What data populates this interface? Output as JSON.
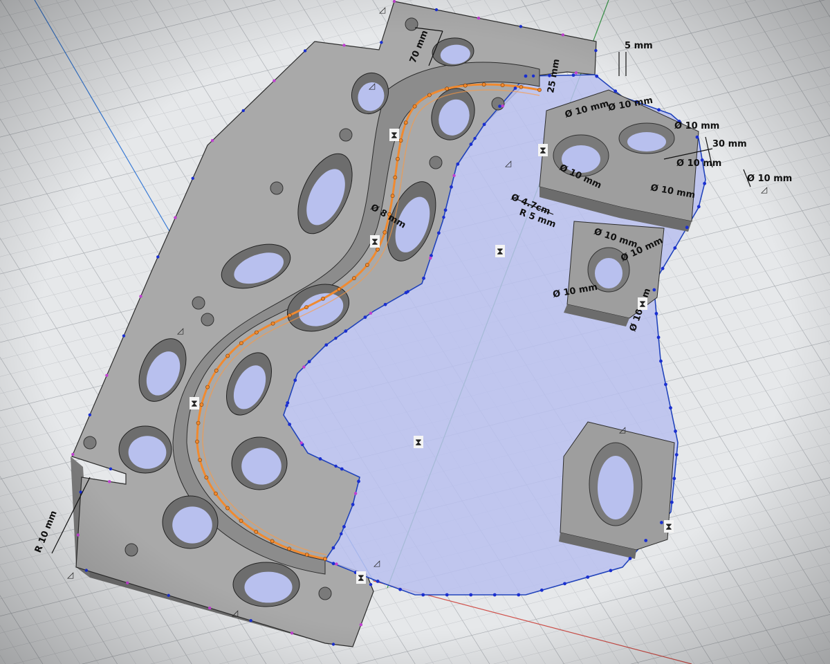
{
  "viewport": {
    "background": "#e4e6e9",
    "grid_color": "#b9bcc1",
    "axis_colors": {
      "x": "#d0504a",
      "y": "#3a9a4a",
      "z": "#3a7bd5"
    }
  },
  "model": {
    "body_color": "#9a9a9a",
    "body_top_color": "#a8a8a8",
    "sketch_profile_color": "#b8c0ee",
    "sketch_line_color": "#2244bb",
    "path_highlight_color": "#f08a30",
    "point_color": "#1a2fd0",
    "construction_point_color": "#c040d0"
  },
  "dimensions": [
    {
      "id": "d70",
      "text": "70 mm"
    },
    {
      "id": "d5",
      "text": "5 mm"
    },
    {
      "id": "d25",
      "text": "25 mm"
    },
    {
      "id": "d30",
      "text": "30 mm"
    },
    {
      "id": "dia10a",
      "text": "Ø 10 mm"
    },
    {
      "id": "dia10b",
      "text": "Ø 10 mm"
    },
    {
      "id": "dia10c",
      "text": "Ø 10 mm"
    },
    {
      "id": "dia10d",
      "text": "Ø 10 mm"
    },
    {
      "id": "dia10e",
      "text": "Ø 10 mm"
    },
    {
      "id": "dia10f",
      "text": "Ø 10 mm"
    },
    {
      "id": "dia10g",
      "text": "Ø 10 mm"
    },
    {
      "id": "dia10h",
      "text": "Ø 10 mm"
    },
    {
      "id": "dia10i",
      "text": "Ø 10 mm"
    },
    {
      "id": "dia10j",
      "text": "Ø 10 mm"
    },
    {
      "id": "dia10k",
      "text": "Ø 10 mm"
    },
    {
      "id": "dia8",
      "text": "Ø 8 mm"
    },
    {
      "id": "dia4",
      "text": "Ø 4.7cm"
    },
    {
      "id": "r5",
      "text": "R 5 mm"
    },
    {
      "id": "r10",
      "text": "R 10 mm"
    }
  ]
}
